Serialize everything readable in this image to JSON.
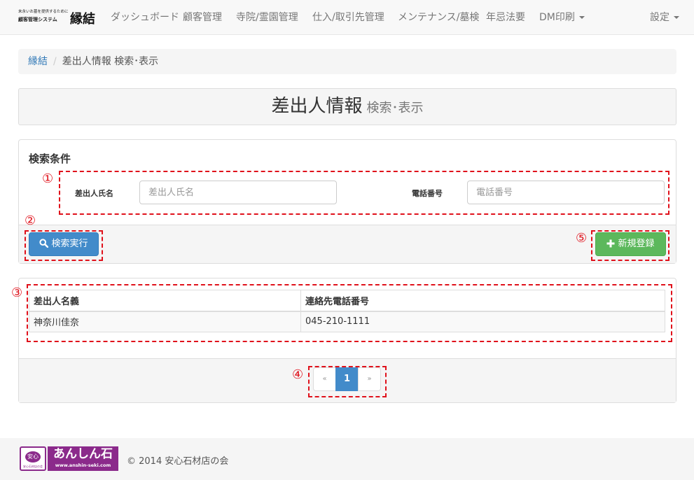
{
  "brand": {
    "tagline_line1": "末永いお墓を提供するために",
    "tagline_line2": "顧客管理システム",
    "name": "縁結"
  },
  "nav": {
    "items": [
      "ダッシュボード",
      "顧客管理",
      "寺院/霊園管理",
      "仕入/取引先管理",
      "メンテナンス/墓検",
      "年忌法要",
      "DM印刷"
    ],
    "settings": "設定"
  },
  "breadcrumb": {
    "home": "縁結",
    "current": "差出人情報 検索･表示"
  },
  "page_header": {
    "title": "差出人情報",
    "subtitle": "検索･表示"
  },
  "search": {
    "title": "検索条件",
    "name_label": "差出人氏名",
    "name_placeholder": "差出人氏名",
    "phone_label": "電話番号",
    "phone_placeholder": "電話番号",
    "search_button": "検索実行",
    "new_button": "新規登録"
  },
  "markers": [
    "①",
    "②",
    "③",
    "④",
    "⑤"
  ],
  "results": {
    "columns": [
      "差出人名義",
      "連絡先電話番号"
    ],
    "rows": [
      [
        "神奈川佳奈",
        "045-210-1111"
      ]
    ]
  },
  "pagination": {
    "prev": "«",
    "current": "1",
    "next": "»"
  },
  "footer": {
    "logo_text": "あんしん石",
    "logo_url": "www.anshin-seki.com",
    "logo_mark": "安心",
    "logo_mark_sub": "安心石材店の会",
    "copyright": "© 2014 安心石材店の会"
  },
  "colors": {
    "primary": "#428bca",
    "success": "#5cb85c",
    "annotation": "#e0111b",
    "logo": "#8b2a8b"
  }
}
